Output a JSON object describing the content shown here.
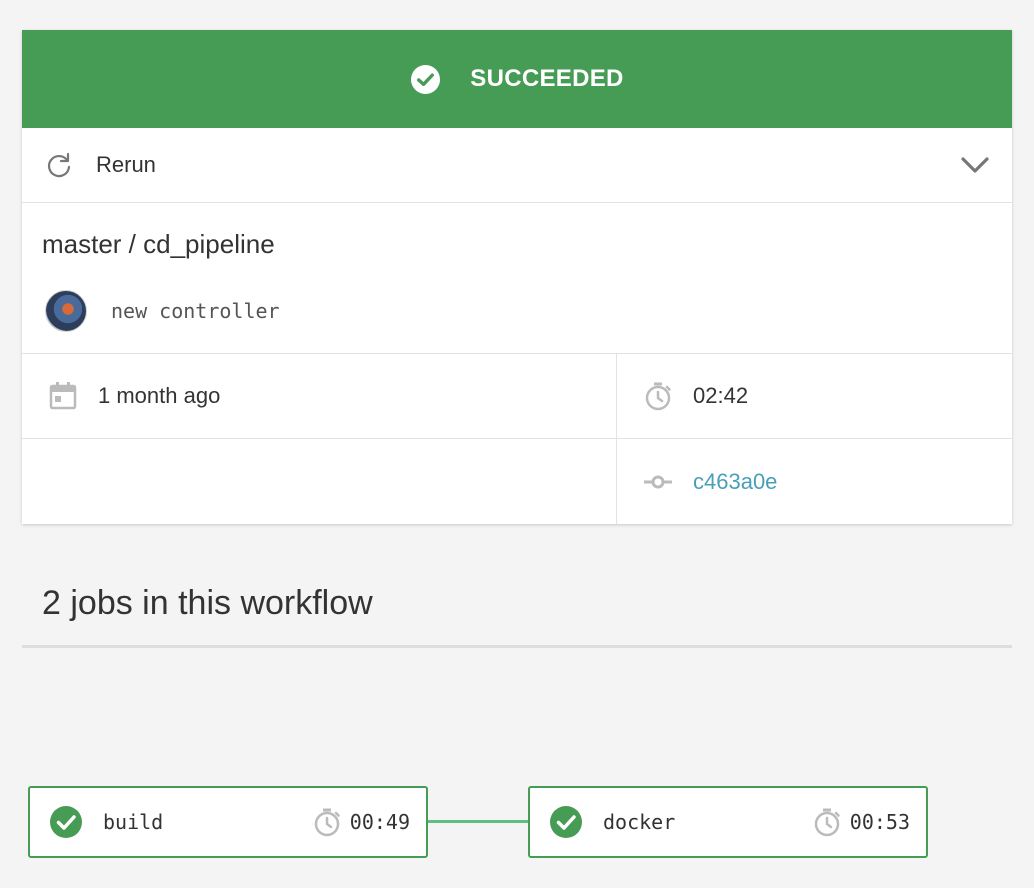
{
  "status": {
    "label": "SUCCEEDED",
    "color": "#469b55",
    "icon": "check-circle-icon"
  },
  "actions": {
    "rerun_label": "Rerun",
    "rerun_icon": "refresh-icon",
    "expand_icon": "chevron-down-icon"
  },
  "workflow": {
    "branch_path": "master / cd_pipeline",
    "commit_message": "new controller",
    "started": "1 month ago",
    "duration": "02:42",
    "commit_hash": "c463a0e",
    "link_color": "#4a9fb8"
  },
  "jobs": {
    "heading": "2 jobs in this workflow",
    "items": [
      {
        "name": "build",
        "duration": "00:49",
        "status": "success"
      },
      {
        "name": "docker",
        "duration": "00:53",
        "status": "success"
      }
    ],
    "connector_color": "#5fbf7f"
  }
}
